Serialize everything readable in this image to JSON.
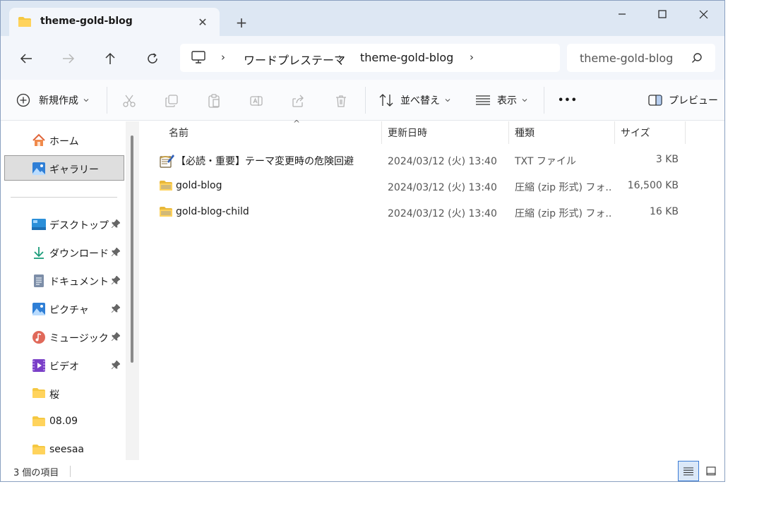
{
  "tab": {
    "title": "theme-gold-blog",
    "close_glyph": "✕",
    "new_tab_glyph": "+"
  },
  "window_controls": {
    "minimize": "—",
    "maximize": "☐",
    "close": "✕"
  },
  "navigation": {
    "back": "←",
    "forward": "→",
    "up": "↑",
    "refresh": "⟳"
  },
  "address": {
    "separator": "›",
    "crumbs": [
      "ワードプレステーマ",
      "theme-gold-blog"
    ]
  },
  "search": {
    "placeholder": "theme-gold-blog"
  },
  "commands": {
    "new": "新規作成",
    "sort": "並べ替え",
    "view": "表示",
    "more": "•••",
    "preview": "プレビュー"
  },
  "sidebar": {
    "home": "ホーム",
    "gallery": "ギャラリー",
    "pinned": [
      {
        "label": "デスクトップ",
        "icon": "desktop-icon"
      },
      {
        "label": "ダウンロード",
        "icon": "download-icon"
      },
      {
        "label": "ドキュメント",
        "icon": "document-icon"
      },
      {
        "label": "ピクチャ",
        "icon": "pictures-icon"
      },
      {
        "label": "ミュージック",
        "icon": "music-icon"
      },
      {
        "label": "ビデオ",
        "icon": "video-icon"
      }
    ],
    "folders": [
      "桜",
      "08.09",
      "seesaa"
    ]
  },
  "columns": {
    "name": "名前",
    "date": "更新日時",
    "type": "種類",
    "size": "サイズ"
  },
  "files": [
    {
      "name": "【必読・重要】テーマ変更時の危険回避",
      "date": "2024/03/12 (火) 13:40",
      "type": "TXT ファイル",
      "size": "3 KB",
      "icon": "text-file-icon"
    },
    {
      "name": "gold-blog",
      "date": "2024/03/12 (火) 13:40",
      "type": "圧縮 (zip 形式) フォ...",
      "size": "16,500 KB",
      "icon": "zip-folder-icon"
    },
    {
      "name": "gold-blog-child",
      "date": "2024/03/12 (火) 13:40",
      "type": "圧縮 (zip 形式) フォ...",
      "size": "16 KB",
      "icon": "zip-folder-icon"
    }
  ],
  "status": {
    "count": "3 個の項目"
  },
  "colors": {
    "accent": "#3a7bd5",
    "titlebar": "#dde7f3",
    "navbar": "#f3f6fb",
    "folder": "#f5c842"
  }
}
